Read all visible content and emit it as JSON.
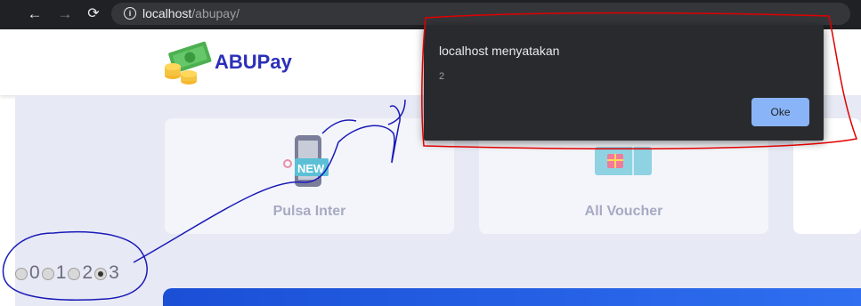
{
  "browser": {
    "url_host": "localhost",
    "url_path": "/abupay/"
  },
  "site": {
    "brand": "ABUPay"
  },
  "cards": [
    {
      "label": "Pulsa Inter",
      "icon": "phone-new-icon"
    },
    {
      "label": "All Voucher",
      "icon": "voucher-ticket-icon"
    },
    {
      "label": "",
      "icon": ""
    }
  ],
  "radios": [
    {
      "label": "0",
      "checked": false
    },
    {
      "label": "1",
      "checked": false
    },
    {
      "label": "2",
      "checked": false
    },
    {
      "label": "3",
      "checked": true
    }
  ],
  "dialog": {
    "title": "localhost menyatakan",
    "message": "2",
    "ok_label": "Oke"
  },
  "colors": {
    "brand": "#2b2fb8",
    "annotation_red": "#e00000",
    "annotation_blue": "#1a1ab8",
    "ok_button": "#8ab4f8"
  }
}
